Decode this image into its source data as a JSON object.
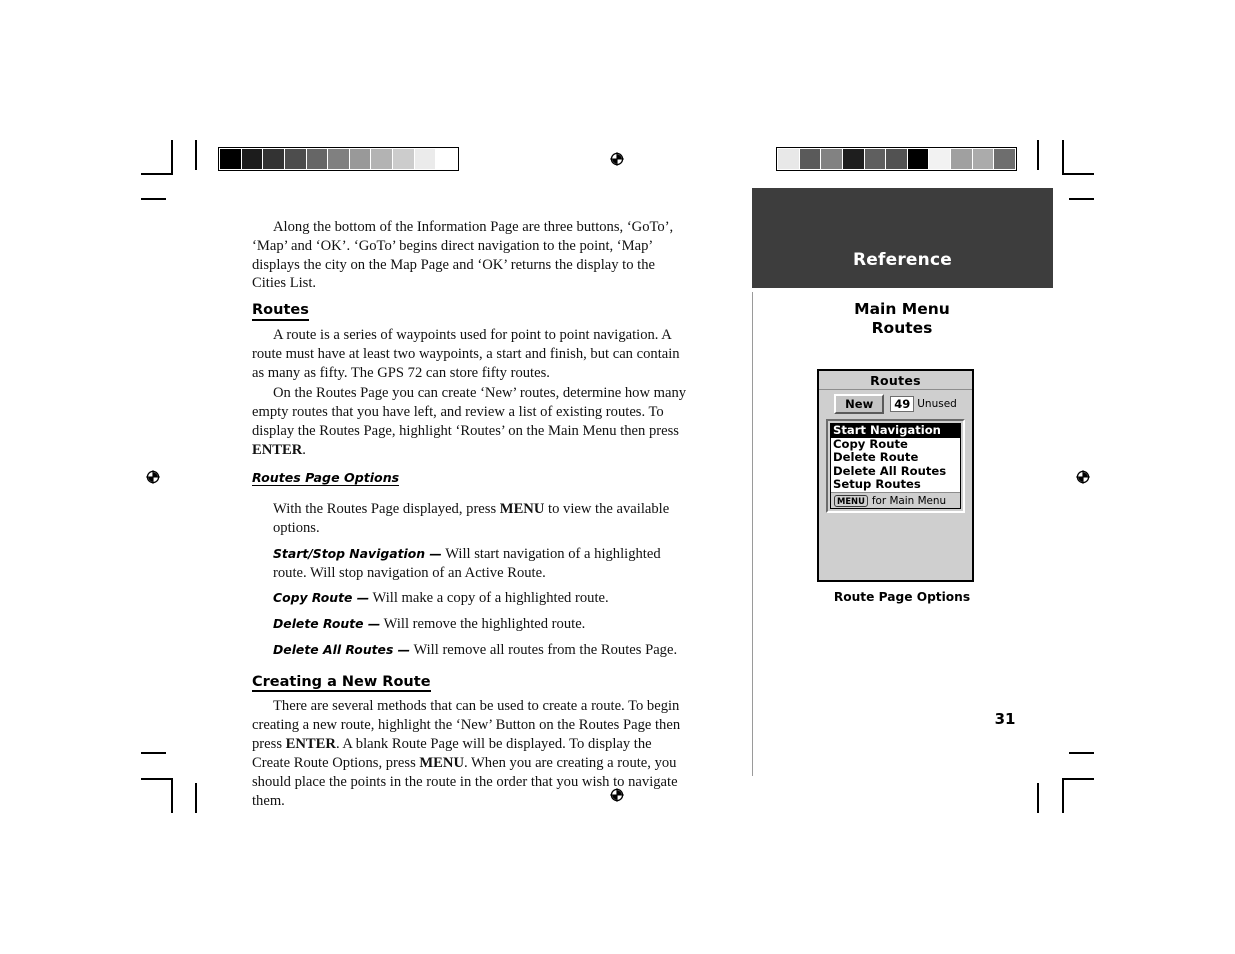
{
  "page": {
    "number": "31",
    "section_header": "Reference",
    "sidebar_title_line1": "Main Menu",
    "sidebar_title_line2": "Routes",
    "figure_caption": "Route Page Options",
    "header_bg": "#3d3d3d",
    "header_text_color": "#ffffff"
  },
  "body": {
    "intro_paragraph": "Along the bottom of the Information Page are three buttons, ‘GoTo’, ‘Map’ and ‘OK’.  ‘GoTo’ begins direct navigation to the point, ‘Map’ displays the city on the Map Page and ‘OK’ returns the display to the Cities List.",
    "routes_heading": "Routes",
    "routes_p1": "A route is a series of waypoints used for point to point navigation.  A route must have at least two waypoints, a start and finish, but can contain as many as fifty. The GPS 72 can store fifty routes.",
    "routes_p2_a": "On the Routes Page you can create ‘New’ routes, determine how many empty routes that you have left, and review a list of existing routes. To display the Routes Page, highlight ‘Routes’ on the Main Menu then press ",
    "routes_p2_key": "ENTER",
    "routes_p2_b": ".",
    "options_heading": "Routes Page Options",
    "options_intro_a": "With the Routes Page displayed, press ",
    "options_intro_key": "MENU",
    "options_intro_b": " to view the available options.",
    "options": [
      {
        "term": "Start/Stop Navigation —",
        "desc": "Will start navigation of a highlighted route.  Will stop navigation of an Active Route."
      },
      {
        "term": "Copy Route —",
        "desc": "Will make a copy of a highlighted route."
      },
      {
        "term": "Delete Route —",
        "desc": "Will remove the highlighted route."
      },
      {
        "term": "Delete All Routes —",
        "desc": "Will remove all routes from the Routes Page."
      }
    ],
    "creating_heading": "Creating a New Route",
    "creating_a": "There are several methods that can be used to create a route. To begin creating a new route, highlight the ‘New’ Button on the Routes Page then press ",
    "creating_key1": "ENTER",
    "creating_b": ". A blank Route Page will be displayed.  To display the Create Route Options, press ",
    "creating_key2": "MENU",
    "creating_c": ".  When you are creating a route, you should place the points in the route in the order that you wish to navigate them."
  },
  "gps_screen": {
    "title": "Routes",
    "new_button": "New",
    "unused_count": "49",
    "unused_label": "Unused",
    "menu_items": [
      {
        "label": "Start Navigation",
        "selected": true
      },
      {
        "label": "Copy Route",
        "selected": false
      },
      {
        "label": "Delete Route",
        "selected": false
      },
      {
        "label": "Delete All Routes",
        "selected": false
      },
      {
        "label": "Setup Routes",
        "selected": false
      }
    ],
    "footer_key": "MENU",
    "footer_label": "for Main Menu"
  },
  "calibration": {
    "left_strip": [
      "#000000",
      "#1c1c1c",
      "#333333",
      "#4d4d4d",
      "#666666",
      "#808080",
      "#999999",
      "#b3b3b3",
      "#cccccc",
      "#ebebeb",
      "#ffffff"
    ],
    "right_strip": [
      "#e8e8e8",
      "#5a5a5a",
      "#828282",
      "#1e1e1e",
      "#5f5f5f",
      "#525252",
      "#000000",
      "#f2f2f2",
      "#a0a0a0",
      "#ababab",
      "#6e6e6e"
    ]
  }
}
